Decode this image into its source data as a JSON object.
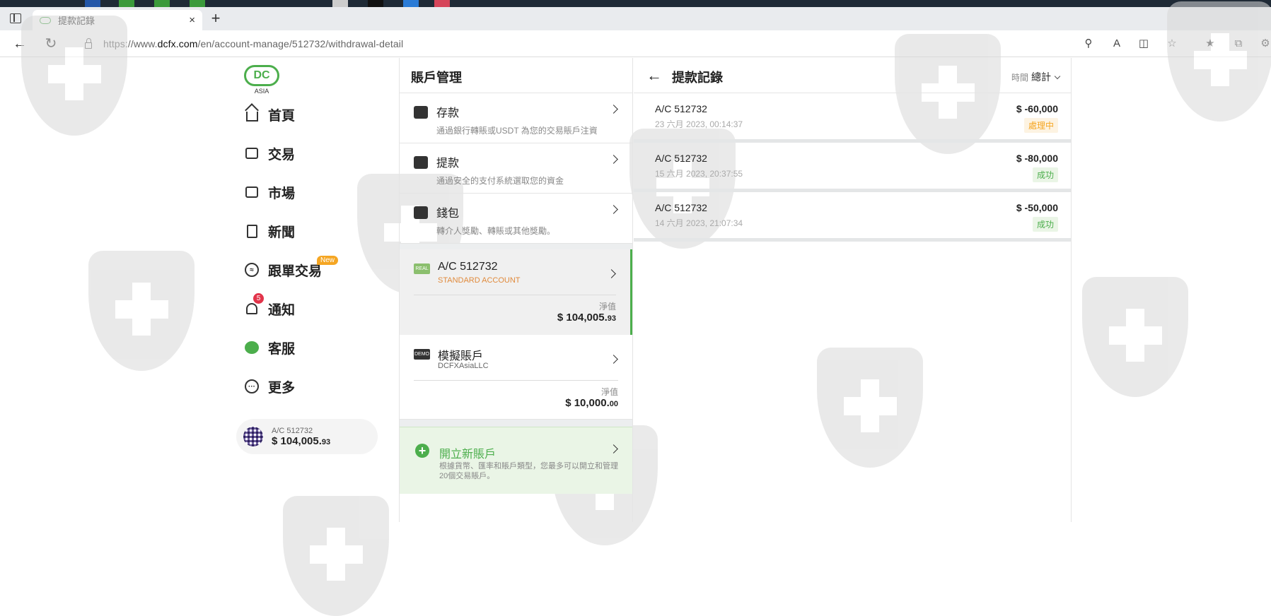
{
  "browser": {
    "tab_title": "提款記錄",
    "tab_close": "×",
    "new_tab": "+",
    "url_prefix": "https://www.",
    "url_domain": "dcfx.com",
    "url_path": "/en/account-manage/512732/withdrawal-detail"
  },
  "brand": {
    "logo_text": "DC",
    "logo_sub": "ASIA",
    "accent": "#4cae4c"
  },
  "nav": {
    "items": [
      {
        "label": "首頁",
        "icon": "home-icon"
      },
      {
        "label": "交易",
        "icon": "trade-icon"
      },
      {
        "label": "市場",
        "icon": "market-icon"
      },
      {
        "label": "新聞",
        "icon": "news-icon"
      },
      {
        "label": "跟單交易",
        "icon": "copy-trade-icon"
      },
      {
        "label": "通知",
        "icon": "bell-icon"
      },
      {
        "label": "客服",
        "icon": "chat-icon"
      },
      {
        "label": "更多",
        "icon": "more-icon"
      }
    ],
    "new_badge": "New",
    "notify_count": "5",
    "account_chip": {
      "account": "A/C 512732",
      "balance_main": "$ 104,005.",
      "balance_cents": "93"
    }
  },
  "account_manage": {
    "title": "賬戶管理",
    "menu": [
      {
        "title": "存款",
        "subtitle": "通過銀行轉賬或USDT 為您的交易賬戶注資"
      },
      {
        "title": "提款",
        "subtitle": "通過安全的支付系統選取您的資金"
      },
      {
        "title": "錢包",
        "subtitle": "轉介人獎勵、轉賬或其他獎勵。"
      }
    ],
    "real_account": {
      "tag": "REAL",
      "title": "A/C 512732",
      "type": "STANDARD ACCOUNT",
      "equity_label": "淨值",
      "balance_main": "$ 104,005.",
      "balance_cents": "93"
    },
    "demo_account": {
      "tag": "DEMO",
      "title": "模擬賬戶",
      "company": "DCFXAsiaLLC",
      "equity_label": "淨值",
      "balance_main": "$ 10,000.",
      "balance_cents": "00"
    },
    "open_account": {
      "title": "開立新賬戶",
      "description": "根據貨幣、匯率和賬戶類型，您最多可以開立和管理20個交易賬戶。"
    }
  },
  "withdrawals": {
    "title": "提款記錄",
    "filter_label": "時間",
    "filter_value": "總計",
    "rows": [
      {
        "account": "A/C 512732",
        "time": "23 六月 2023, 00:14:37",
        "amount": "$ -60,000",
        "status": "處理中",
        "status_color": "#f5a623",
        "status_bg": "#fdf3e2"
      },
      {
        "account": "A/C 512732",
        "time": "15 六月 2023, 20:37:55",
        "amount": "$ -80,000",
        "status": "成功",
        "status_color": "#4cae4c",
        "status_bg": "#eaf5e6"
      },
      {
        "account": "A/C 512732",
        "time": "14 六月 2023, 21:07:34",
        "amount": "$ -50,000",
        "status": "成功",
        "status_color": "#4cae4c",
        "status_bg": "#eaf5e6"
      }
    ]
  }
}
